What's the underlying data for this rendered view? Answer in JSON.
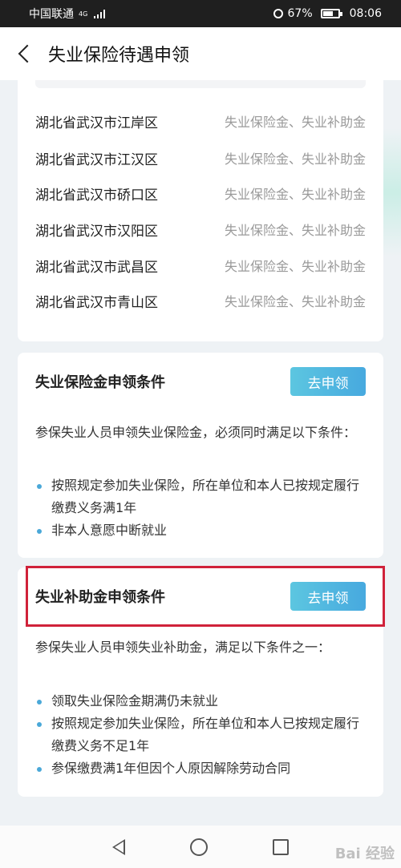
{
  "status_bar": {
    "carrier": "中国联通",
    "network": "4G",
    "battery": "67%",
    "battery_level": 0.67,
    "time": "08:06"
  },
  "header": {
    "title": "失业保险待遇申领"
  },
  "regions": [
    {
      "name": "湖北省武汉市江岸区",
      "types": "失业保险金、失业补助金"
    },
    {
      "name": "湖北省武汉市江汉区",
      "types": "失业保险金、失业补助金"
    },
    {
      "name": "湖北省武汉市硚口区",
      "types": "失业保险金、失业补助金"
    },
    {
      "name": "湖北省武汉市汉阳区",
      "types": "失业保险金、失业补助金"
    },
    {
      "name": "湖北省武汉市武昌区",
      "types": "失业保险金、失业补助金"
    },
    {
      "name": "湖北省武汉市青山区",
      "types": "失业保险金、失业补助金"
    }
  ],
  "insurance_card": {
    "title": "失业保险金申领条件",
    "button": "去申领",
    "desc": "参保失业人员申领失业保险金，必须同时满足以下条件：",
    "bullets": [
      "按照规定参加失业保险，所在单位和本人已按规定履行缴费义务满1年",
      "非本人意愿中断就业"
    ]
  },
  "subsidy_card": {
    "title": "失业补助金申领条件",
    "button": "去申领",
    "desc": "参保失业人员申领失业补助金，满足以下条件之一：",
    "bullets": [
      "领取失业保险金期满仍未就业",
      "按照规定参加失业保险，所在单位和本人已按规定履行缴费义务不足1年",
      "参保缴费满1年但因个人原因解除劳动合同"
    ]
  },
  "watermark": "Bai 经验",
  "colors": {
    "accent": "#47a9df",
    "highlight": "#d0223a"
  }
}
